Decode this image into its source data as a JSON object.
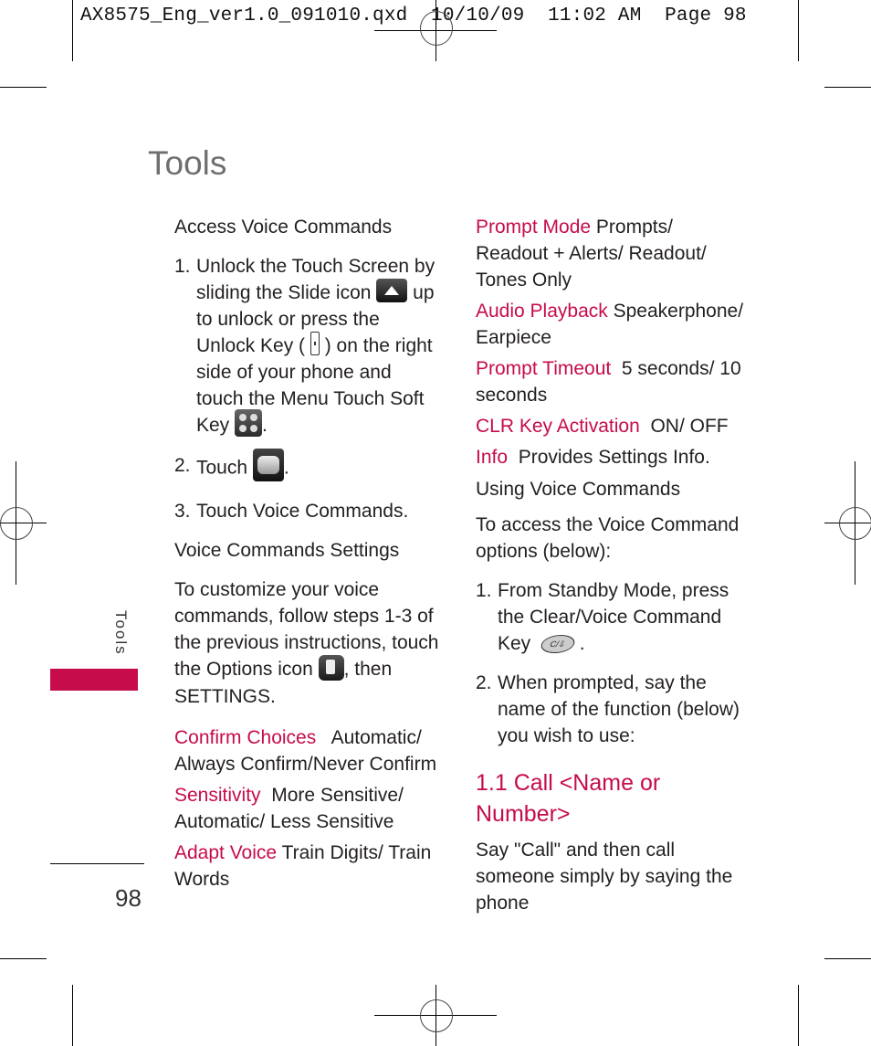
{
  "slug": "AX8575_Eng_ver1.0_091010.qxd  10/10/09  11:02 AM  Page 98",
  "page": {
    "title": "Tools",
    "side_tab": "Tools",
    "number": "98",
    "accent_color": "#c60c4a"
  },
  "left": {
    "access_heading": "Access Voice Commands",
    "step1": {
      "num": "1.",
      "a": "Unlock the Touch Screen by sliding the Slide icon",
      "b": "up to unlock or press the Unlock Key (",
      "c": ") on the right side of your phone and touch the Menu Touch Soft Key",
      "d": "."
    },
    "step2": {
      "num": "2.",
      "a": "Touch",
      "b": "."
    },
    "step3": {
      "num": "3.",
      "a": "Touch ",
      "bold": "Voice Commands",
      "b": "."
    },
    "settings_heading": "Voice Commands Settings",
    "settings_intro_a": "To customize your voice commands, follow steps 1-3 of the previous instructions, touch the Options icon",
    "settings_intro_b": ", then",
    "settings_intro_bold": "SETTINGS",
    "settings_intro_c": ".",
    "options": [
      {
        "label": "Confirm Choices",
        "value": "Automatic/ Always Confirm/Never Confirm"
      },
      {
        "label": "Sensitivity",
        "value": "More Sensitive/ Automatic/ Less Sensitive"
      },
      {
        "label": "Adapt Voice",
        "value": "Train Digits/ Train Words"
      }
    ]
  },
  "right": {
    "options": [
      {
        "label": "Prompt Mode",
        "value": "Prompts/ Readout + Alerts/ Readout/ Tones Only"
      },
      {
        "label": "Audio Playback",
        "value": "Speakerphone/ Earpiece"
      },
      {
        "label": "Prompt Timeout",
        "value": "5 seconds/ 10 seconds"
      },
      {
        "label": "CLR Key Activation",
        "value": "ON/ OFF"
      },
      {
        "label": "Info",
        "value": "Provides Settings Info."
      }
    ],
    "using_heading": "Using Voice Commands",
    "using_intro": "To access the Voice Command options (below):",
    "step1": {
      "num": "1.",
      "a": "From Standby Mode, press the Clear/Voice Command Key",
      "b": ".",
      "key_glyph": "C/⇩"
    },
    "step2": {
      "num": "2.",
      "a": "When prompted, say the name of the function (below) you wish to use:"
    },
    "section_title": "1.1 Call <Name or Number>",
    "section_body": "Say \"Call\" and then call someone simply by saying the phone"
  }
}
